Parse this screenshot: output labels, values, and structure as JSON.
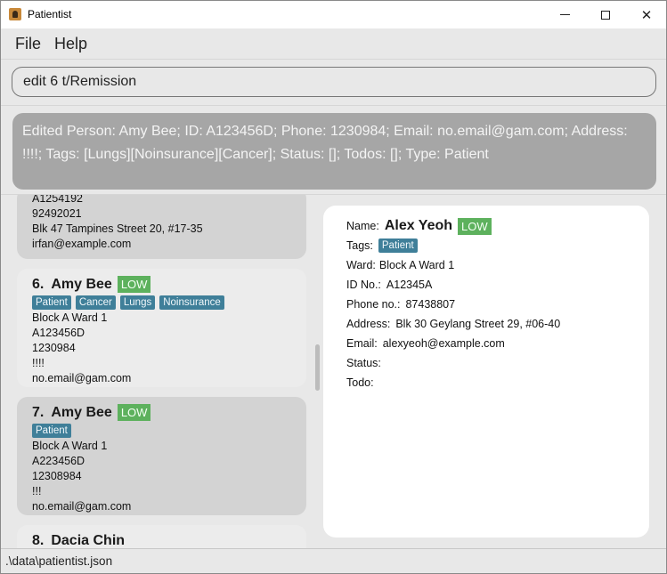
{
  "window": {
    "title": "Patientist"
  },
  "menu": {
    "file": "File",
    "help": "Help"
  },
  "command": {
    "value": "edit 6 t/Remission"
  },
  "result": {
    "text": "Edited Person: Amy Bee; ID: A123456D; Phone: 1230984; Email: no.email@gam.com; Address: !!!!; Tags: [Lungs][Noinsurance][Cancer]; Status: []; Todos: []; Type: Patient"
  },
  "list": {
    "partial_top": {
      "lines": [
        "A1254192",
        "92492021",
        "Blk 47 Tampines Street 20, #17-35",
        "irfan@example.com"
      ]
    },
    "cards": [
      {
        "index": "6.",
        "name": "Amy Bee",
        "priority": "LOW",
        "tags": [
          "Patient",
          "Cancer",
          "Lungs",
          "Noinsurance"
        ],
        "ward": "Block A Ward 1",
        "id": "A123456D",
        "phone": "1230984",
        "address": "!!!!",
        "email": "no.email@gam.com"
      },
      {
        "index": "7.",
        "name": "Amy Bee",
        "priority": "LOW",
        "tags": [
          "Patient"
        ],
        "ward": "Block A Ward 1",
        "id": "A223456D",
        "phone": "12308984",
        "address": "!!!",
        "email": "no.email@gam.com"
      }
    ],
    "partial_bottom": {
      "index": "8.",
      "name": "Dacia Chin"
    }
  },
  "detail": {
    "name_label": "Name:",
    "name": "Alex Yeoh",
    "priority": "LOW",
    "tags_label": "Tags:",
    "tags": [
      "Patient"
    ],
    "ward_label": "Ward:",
    "ward": "Block A Ward 1",
    "id_label": "ID No.:",
    "id": "A12345A",
    "phone_label": "Phone no.:",
    "phone": "87438807",
    "address_label": "Address:",
    "address": "Blk 30 Geylang Street 29, #06-40",
    "email_label": "Email:",
    "email": "alexyeoh@example.com",
    "status_label": "Status:",
    "todo_label": "Todo:"
  },
  "status_bar": {
    "path": ".\\data\\patientist.json"
  },
  "colors": {
    "priority_low": "#5db15d",
    "tag": "#3f7f99",
    "result_bg": "#a6a6a6"
  }
}
